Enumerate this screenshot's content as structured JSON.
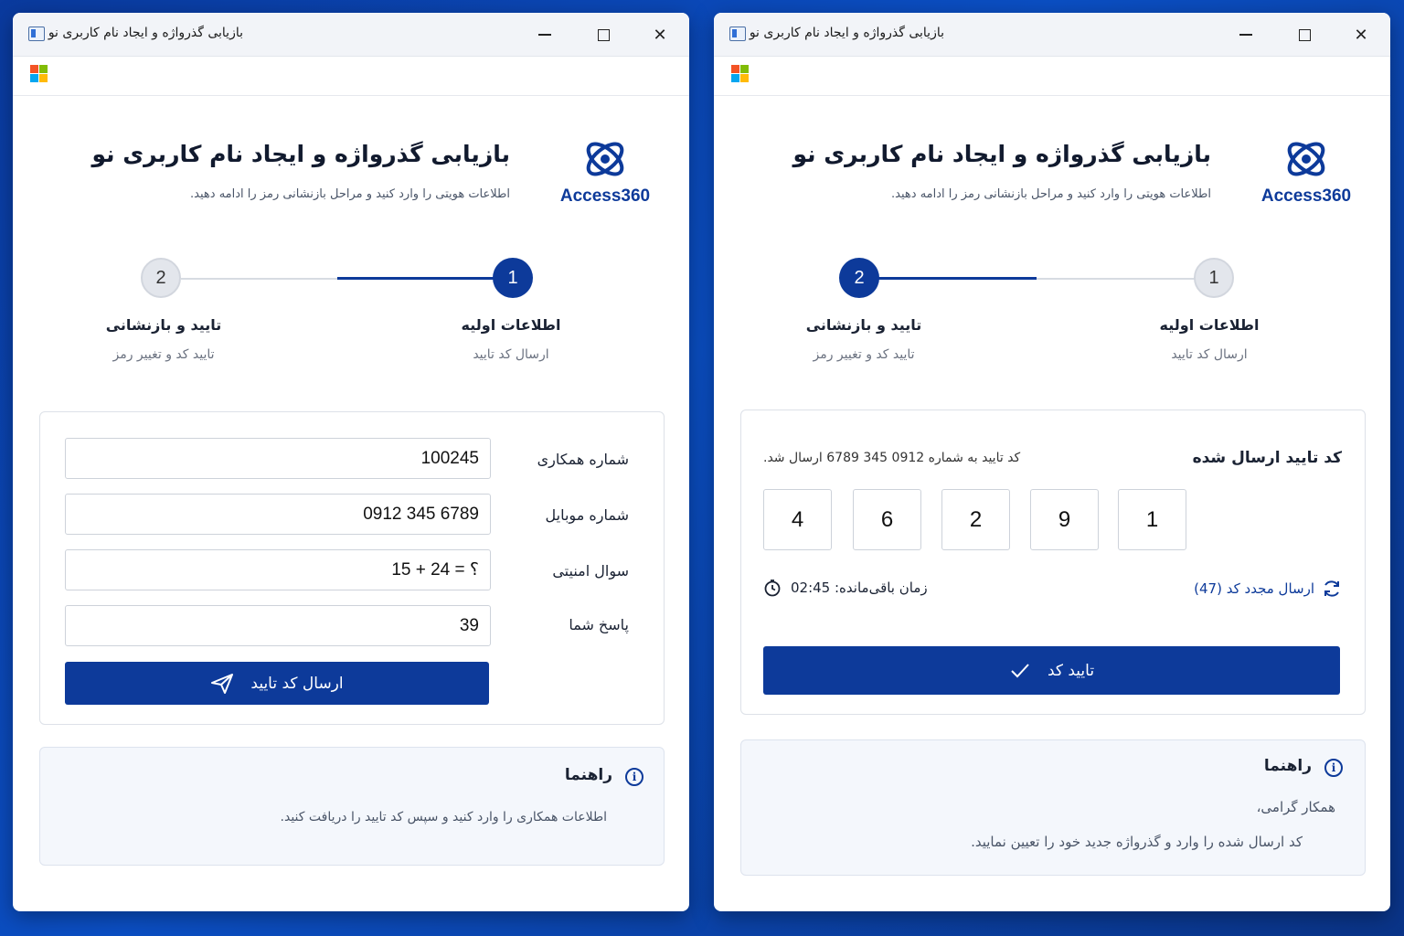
{
  "window_title": "بازیابی گذرواژه و ایجاد نام کاربری نو",
  "header": {
    "title": "بازیابی گذرواژه و ایجاد نام کاربری نو",
    "subtitle": "اطلاعات هویتی را وارد کنید و مراحل بازنشانی رمز را ادامه دهید.",
    "brand": "Access360"
  },
  "steps": [
    {
      "number": "1",
      "label": "اطلاعات اولیه",
      "sub": "ارسال کد تایید"
    },
    {
      "number": "2",
      "label": "تایید و بازنشانی",
      "sub": "تایید کد و تغییر رمز"
    }
  ],
  "left": {
    "active_step": 1,
    "form": {
      "fields": [
        {
          "label": "شماره همکاری",
          "value": "100245"
        },
        {
          "label": "شماره موبایل",
          "value": "0912 345 6789"
        },
        {
          "label": "سوال امنیتی",
          "value": "15 + 24 = ؟"
        },
        {
          "label": "پاسخ شما",
          "value": "39"
        }
      ],
      "submit_label": "ارسال کد تایید"
    },
    "guide": {
      "title": "راهنما",
      "text": "اطلاعات همکاری را وارد کنید و سپس کد تایید را دریافت کنید."
    }
  },
  "right": {
    "active_step": 2,
    "otp": {
      "title": "کد تایید ارسال شده",
      "info": "کد تایید به شماره 0912 345 6789 ارسال شد.",
      "digits": [
        "1",
        "9",
        "2",
        "6",
        "4"
      ],
      "resend_label": "ارسال مجدد کد (47)",
      "timer_label": "زمان باقی‌مانده: 02:45",
      "confirm_label": "تایید کد"
    },
    "guide": {
      "title": "راهنما",
      "line1": "همکار گرامی،",
      "line2": "کد ارسال شده را وارد و گذرواژه جدید خود را تعیین نمایید."
    }
  },
  "colors": {
    "accent": "#0d3a9a",
    "background": "#0b4fc4"
  }
}
